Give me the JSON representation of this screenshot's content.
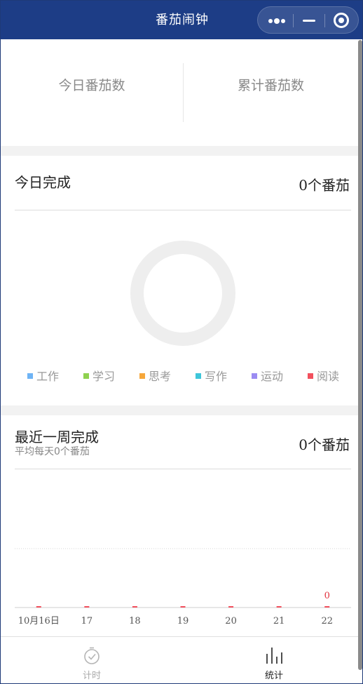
{
  "header": {
    "title": "番茄闹钟"
  },
  "capsule": {
    "more_icon": "more-dots-icon",
    "minimize_icon": "minimize-icon",
    "close_icon": "target-close-icon"
  },
  "summary": {
    "today_label": "今日番茄数",
    "total_label": "累计番茄数"
  },
  "today": {
    "title": "今日完成",
    "count": "0个番茄",
    "legend": [
      {
        "label": "工作",
        "color": "#6fb4f5"
      },
      {
        "label": "学习",
        "color": "#8fd14f"
      },
      {
        "label": "思考",
        "color": "#f6a73b"
      },
      {
        "label": "写作",
        "color": "#3ec6da"
      },
      {
        "label": "运动",
        "color": "#9b8cf2"
      },
      {
        "label": "阅读",
        "color": "#f2505d"
      }
    ]
  },
  "week": {
    "title": "最近一周完成",
    "subtitle": "平均每天0个番茄",
    "count": "0个番茄"
  },
  "chart_data": {
    "type": "bar",
    "categories": [
      "10月16日",
      "17",
      "18",
      "19",
      "20",
      "21",
      "22"
    ],
    "values": [
      0,
      0,
      0,
      0,
      0,
      0,
      0
    ],
    "data_labels": [
      "",
      "",
      "",
      "",
      "",
      "",
      "0"
    ],
    "bar_color": "#f2505d",
    "label_color": "#e2323e",
    "grid": true
  },
  "tabbar": {
    "items": [
      {
        "label": "计时",
        "icon": "stopwatch-icon",
        "active": false
      },
      {
        "label": "统计",
        "icon": "bar-chart-icon",
        "active": true
      }
    ]
  }
}
